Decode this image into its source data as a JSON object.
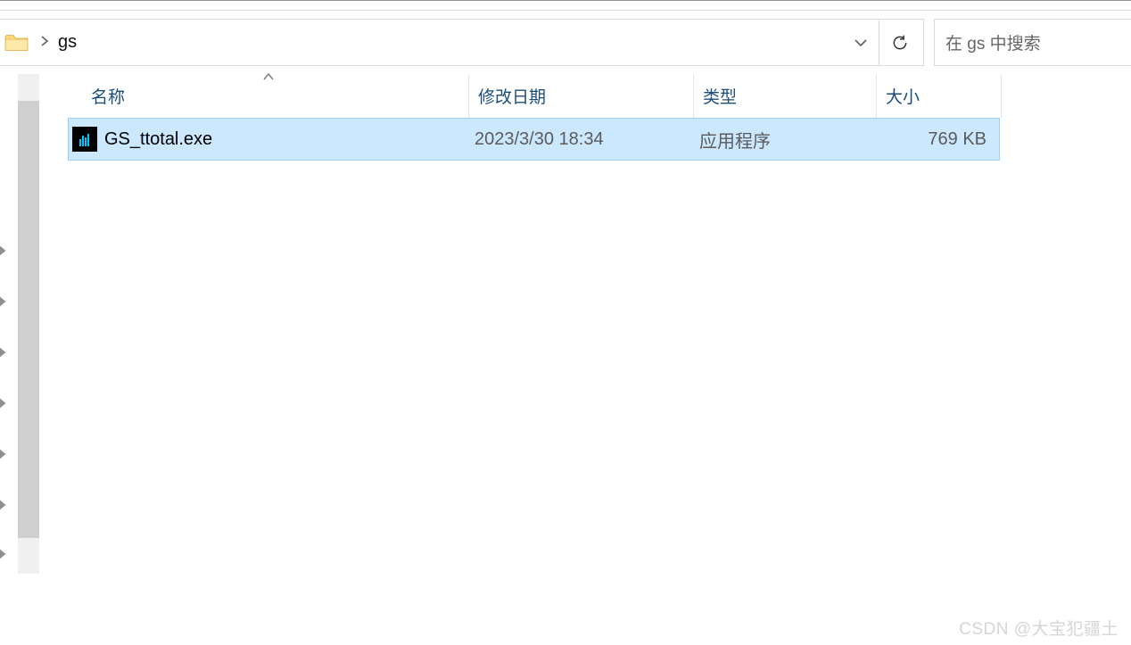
{
  "breadcrumb": {
    "current": "gs"
  },
  "search": {
    "placeholder": "在 gs 中搜索"
  },
  "columns": {
    "name": "名称",
    "date": "修改日期",
    "type": "类型",
    "size": "大小"
  },
  "files": [
    {
      "name": "GS_ttotal.exe",
      "date": "2023/3/30 18:34",
      "type": "应用程序",
      "size": "769 KB"
    }
  ],
  "watermark": "CSDN @大宝犯疆土"
}
